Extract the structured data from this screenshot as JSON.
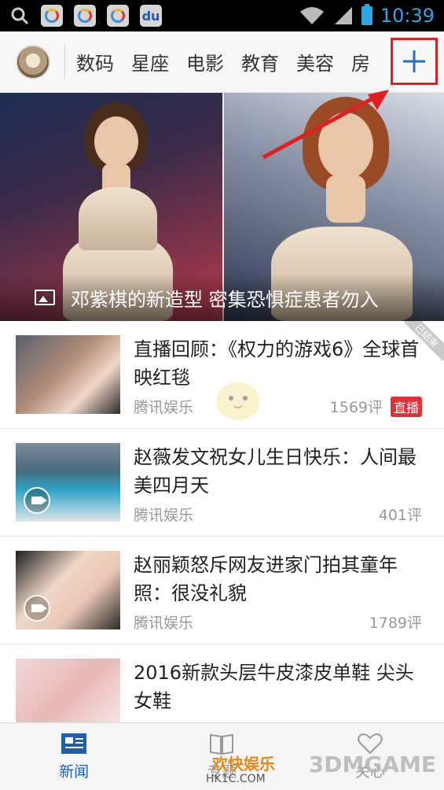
{
  "status_bar": {
    "time": "10:39",
    "icons": [
      "search-icon",
      "app-icon",
      "app-icon",
      "app-icon",
      "baidu-icon",
      "wifi-icon",
      "signal-icon",
      "battery-icon"
    ]
  },
  "channel_bar": {
    "channels": [
      "数码",
      "星座",
      "电影",
      "教育",
      "美容",
      "房"
    ],
    "add_label": "+"
  },
  "hero": {
    "caption": "邓紫棋的新造型 密集恐惧症患者勿入"
  },
  "news": [
    {
      "title": "直播回顾：《权力的游戏6》全球首映红毯",
      "source": "腾讯娱乐",
      "comments": "1569评",
      "badge": "直播",
      "ribbon": "已结束"
    },
    {
      "title": "赵薇发文祝女儿生日快乐：人间最美四月天",
      "source": "腾讯娱乐",
      "comments": "401评"
    },
    {
      "title": "赵丽颖怒斥网友进家门拍其童年照：很没礼貌",
      "source": "腾讯娱乐",
      "comments": "1789评"
    },
    {
      "title": "2016新款头层牛皮漆皮单鞋 尖头女鞋",
      "source": "",
      "comments": ""
    }
  ],
  "bottom_nav": {
    "items": [
      {
        "label": "新闻",
        "active": true
      },
      {
        "label": "专题",
        "active": false
      },
      {
        "label": "关心",
        "active": false
      }
    ]
  },
  "watermarks": {
    "brand": "3DMGAME",
    "site": "欢快娱乐",
    "url": "HK1C.COM"
  },
  "colors": {
    "accent": "#1f5fb0",
    "status_time": "#2fa6e5",
    "highlight_red": "#e02020",
    "live_badge": "#e0313b"
  }
}
